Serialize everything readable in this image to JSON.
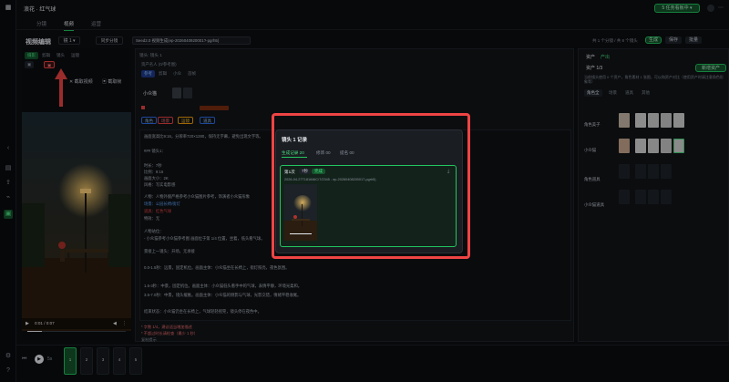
{
  "app": {
    "title": "浪花 · 红气球",
    "top_right_button": "5 任务看板中 ▾"
  },
  "tabs": [
    {
      "label": "分镜",
      "active": false
    },
    {
      "label": "视频",
      "active": true
    },
    {
      "label": "运营",
      "active": false
    }
  ],
  "editor": {
    "title": "视频编辑",
    "shot_label": "镜 1 ▾",
    "sync_button": "同步分镜",
    "model_select": "Seed2.0 视频生成(ep-2026040920001?-pgrh5)",
    "left_chips": [
      "摄影",
      "剪辑",
      "镜头",
      "运镜"
    ],
    "left_actions": [
      "截取视频",
      "截取帧"
    ],
    "top_right_count": "共 1 个分镜 / 共 8 个镜头",
    "top_right_buttons": [
      "生成",
      "保存",
      "批量"
    ]
  },
  "player": {
    "time": "0:01 / 0:07"
  },
  "scene": {
    "heading": "镜头: 镜头 1",
    "sub": "资产名人 (0/参考图)",
    "tags": [
      "参考",
      "剪辑",
      "小众",
      "首帧"
    ],
    "character_label": "小众猫",
    "option_chips": [
      "角色",
      "场景",
      "运镜",
      "道具"
    ],
    "option_chips2": [
      "风格",
      "台词/音效",
      "镜头描述",
      "分镜参考"
    ],
    "body_lines": [
      "画面宽高比9:16，分辨率720×1280，保持无字幕，避免出现文字等。",
      "",
      "### 镜头1：",
      "",
      "时长：7秒",
      "比例：9:16",
      "画面大小：2K",
      "风格：写实电影感",
      "",
      "人物：人物外貌严格参考小众猫图片参考，饰演者小众猫形象",
      "场景：公园长椅/街灯",
      "道具：红色气球",
      "特效：无",
      "",
      "人物站位：",
      "- 小众猫参考小众猫参考图 画面位于第 1/4 位置，坐着，低头看气球。",
      "",
      "景接上一镜头：开场，无承接",
      "",
      "0.0-1.5秒：远景，固定机位。画面主体：小众猫坐在长椅上，街灯照亮，夜色氛围。",
      "1.5-3秒：中景，固定机位。画面主体：小众猫低头看手中的气球，表情平静，环境光柔和。",
      "3.5-7.0秒：中景，镜头缓推。画面主体：小众猫的侧影与气球，光影交错，情绪平稳收尾。",
      "",
      "结束状态：小众猫仍坐在长椅上，气球轻轻摇晃，镜头停在夜色中。"
    ],
    "notes": [
      "* 字数 1/4，建议适当增加描述",
      "* 不超过时长请检查（最少 1 秒）",
      "复制提示"
    ]
  },
  "modal": {
    "title": "镜头 1 记录",
    "tabs": [
      "生成记录 20",
      "修饰 00",
      "提名 00"
    ],
    "record_title": "第1次",
    "record_badge1": "7秒",
    "record_badge2": "完成",
    "record_meta": "2026-04-27T181646C/7/2345 - ep-20260408200017-pgrh5)",
    "download_icon": "download-icon"
  },
  "right": {
    "header": "资产 1/3",
    "tabs": [
      "资产",
      "产出"
    ],
    "generate_button": "新增资产",
    "hint": "当前镜头使用 0 个资产，角色素材 1 张图，可以和资产对比（使用资产时请注意角色形象等）",
    "filters": [
      "角色全",
      "场景",
      "道具",
      "其他"
    ],
    "rows": [
      {
        "label": "角色美子"
      },
      {
        "label": "小众猫"
      },
      {
        "label": "角色道具"
      },
      {
        "label": "小众猫道具"
      }
    ]
  },
  "timeline": {
    "play_time": "5s",
    "clips": [
      "1",
      "2",
      "3",
      "4",
      "5"
    ]
  },
  "colors": {
    "accent": "#22c55e",
    "highlight": "#ef4444",
    "bg": "#0d0f12"
  }
}
